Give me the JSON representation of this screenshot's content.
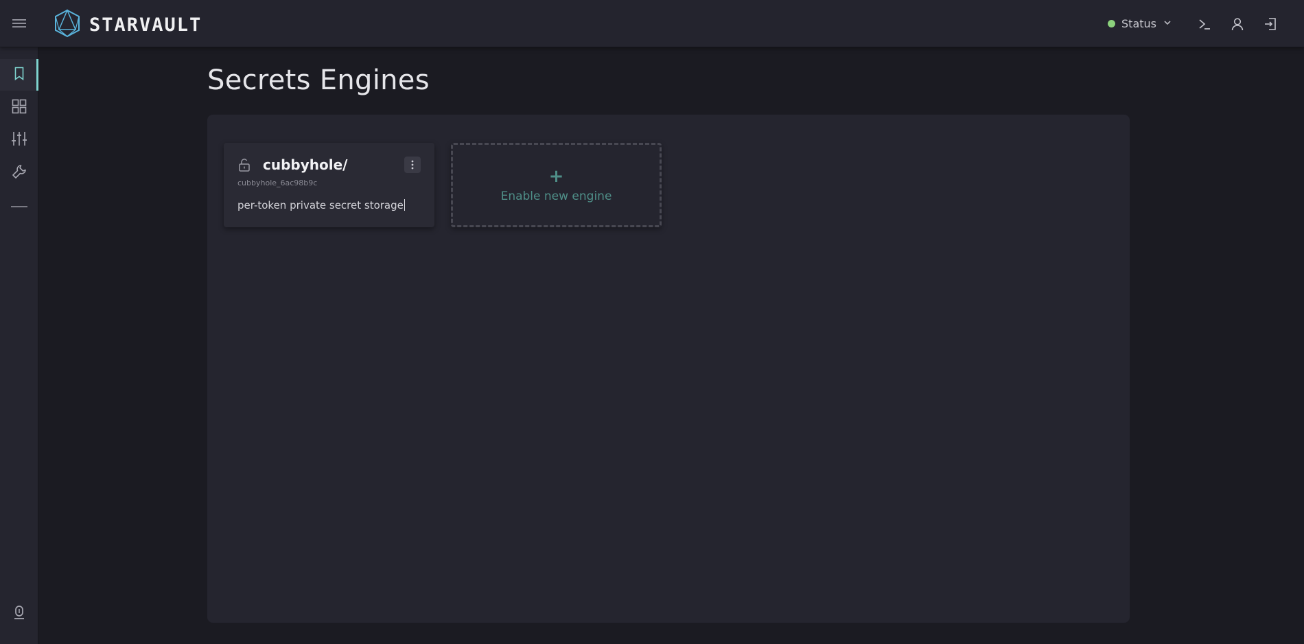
{
  "app": {
    "brand": "STARVAULT"
  },
  "header": {
    "status_label": "Status",
    "status_color": "#8bd17c",
    "icons": [
      "menu-icon",
      "chevron-down-icon",
      "terminal-icon",
      "user-icon",
      "sign-out-icon"
    ]
  },
  "sidebar": {
    "items": [
      {
        "icon": "bookmark-icon",
        "active": true
      },
      {
        "icon": "grid-icon",
        "active": false
      },
      {
        "icon": "sliders-icon",
        "active": false
      },
      {
        "icon": "wrench-icon",
        "active": false
      },
      {
        "icon": "divider",
        "active": false
      }
    ],
    "bottom_icon": "storage-icon",
    "accent_color": "#7fd4cf"
  },
  "main": {
    "title": "Secrets Engines",
    "engines": [
      {
        "name": "cubbyhole/",
        "id": "cubbyhole_6ac98b9c",
        "description": "per-token private secret storage",
        "icon": "unlock-icon"
      }
    ],
    "enable_card": {
      "plus": "+",
      "label": "Enable new engine",
      "color": "#4f8f88"
    }
  }
}
